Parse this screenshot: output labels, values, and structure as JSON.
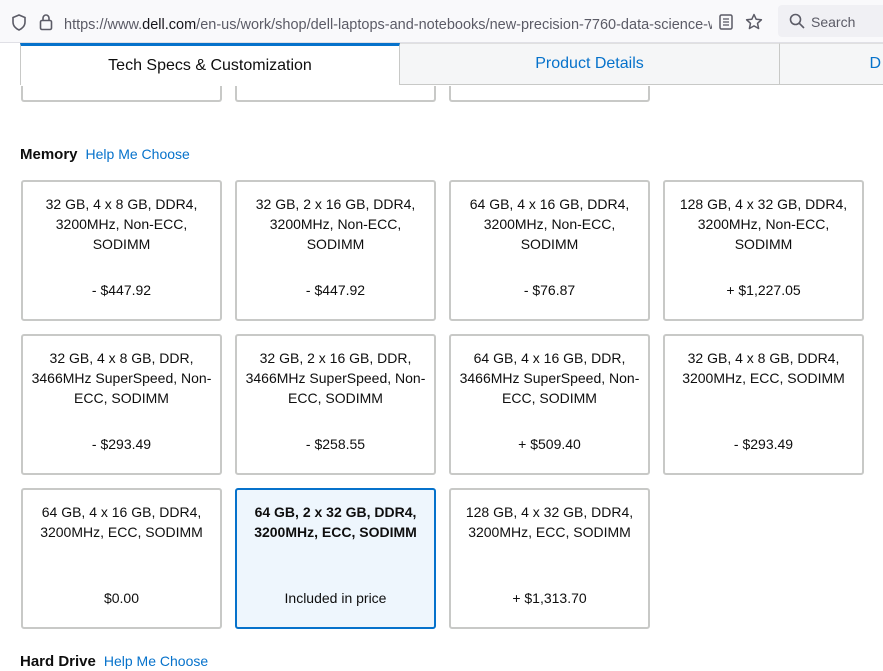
{
  "browser": {
    "url_prefix": "https://www.",
    "url_host": "dell.com",
    "url_path": "/en-us/work/shop/dell-laptops-and-notebooks/new-precision-7760-data-science-w",
    "search_label": "Search"
  },
  "tabs": [
    {
      "label": "Tech Specs & Customization"
    },
    {
      "label": "Product Details"
    },
    {
      "label": "D"
    }
  ],
  "memory": {
    "title": "Memory",
    "help": "Help Me Choose",
    "options": [
      {
        "desc": "32 GB, 4 x 8 GB, DDR4, 3200MHz, Non-ECC, SODIMM",
        "price": "- $447.92"
      },
      {
        "desc": "32 GB, 2 x 16 GB, DDR4, 3200MHz, Non-ECC, SODIMM",
        "price": "- $447.92"
      },
      {
        "desc": "64 GB, 4 x 16 GB, DDR4, 3200MHz, Non-ECC, SODIMM",
        "price": "- $76.87"
      },
      {
        "desc": "128 GB, 4 x 32 GB, DDR4, 3200MHz, Non-ECC, SODIMM",
        "price": "+ $1,227.05"
      },
      {
        "desc": "32 GB, 4 x 8 GB, DDR, 3466MHz SuperSpeed, Non-ECC, SODIMM",
        "price": "- $293.49"
      },
      {
        "desc": "32 GB, 2 x 16 GB, DDR, 3466MHz SuperSpeed, Non-ECC, SODIMM",
        "price": "- $258.55"
      },
      {
        "desc": "64 GB, 4 x 16 GB, DDR, 3466MHz SuperSpeed, Non-ECC, SODIMM",
        "price": "+ $509.40"
      },
      {
        "desc": "32 GB, 4 x 8 GB, DDR4, 3200MHz, ECC, SODIMM",
        "price": "- $293.49"
      },
      {
        "desc": "64 GB, 4 x 16 GB, DDR4, 3200MHz, ECC, SODIMM",
        "price": "$0.00"
      },
      {
        "desc": "64 GB, 2 x 32 GB, DDR4, 3200MHz, ECC, SODIMM",
        "price": "Included in price"
      },
      {
        "desc": "128 GB, 4 x 32 GB, DDR4, 3200MHz, ECC, SODIMM",
        "price": "+ $1,313.70"
      }
    ]
  },
  "hard_drive": {
    "title": "Hard Drive",
    "help": "Help Me Choose"
  },
  "colors": {
    "accent": "#0672cb",
    "selected_bg": "#eef6fd",
    "card_border": "#c8c9c7"
  }
}
